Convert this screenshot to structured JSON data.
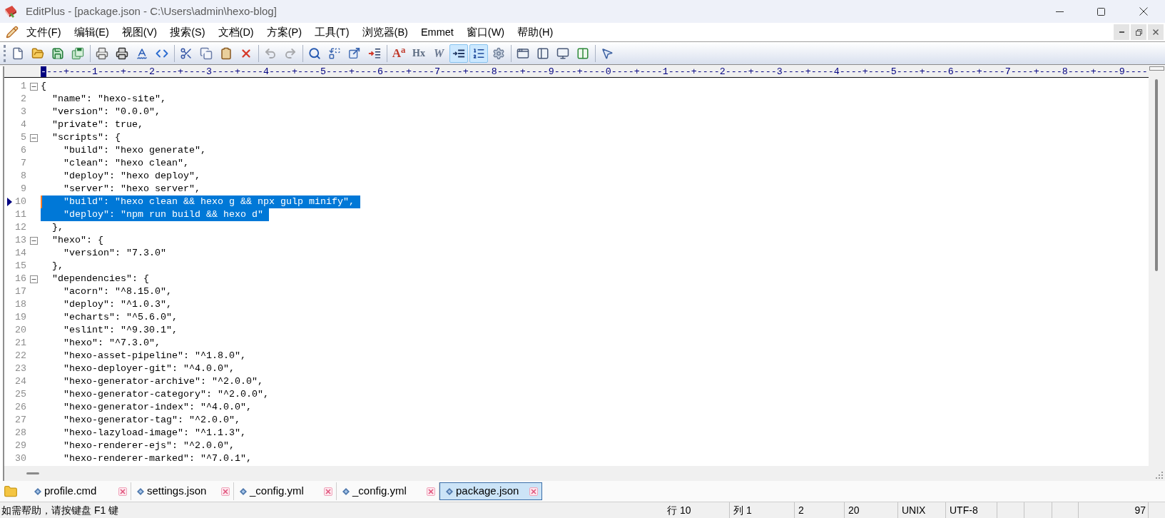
{
  "window": {
    "title": "EditPlus - [package.json - C:\\Users\\admin\\hexo-blog]"
  },
  "menu": [
    "文件(F)",
    "编辑(E)",
    "视图(V)",
    "搜索(S)",
    "文档(D)",
    "方案(P)",
    "工具(T)",
    "浏览器(B)",
    "Emmet",
    "窗口(W)",
    "帮助(H)"
  ],
  "toolbar": {
    "groups": [
      {
        "buttons": [
          {
            "pressed": false,
            "disabled": false
          },
          {
            "pressed": false,
            "disabled": false
          },
          {
            "pressed": false,
            "disabled": false
          },
          {
            "pressed": false,
            "disabled": false
          }
        ]
      },
      {
        "buttons": [
          {
            "pressed": false,
            "disabled": false
          },
          {
            "pressed": false,
            "disabled": false
          },
          {
            "pressed": false,
            "disabled": false
          },
          {
            "pressed": false,
            "disabled": false
          }
        ]
      },
      {
        "buttons": [
          {
            "pressed": false,
            "disabled": false
          },
          {
            "pressed": false,
            "disabled": false
          },
          {
            "pressed": false,
            "disabled": false
          },
          {
            "pressed": false,
            "disabled": false
          }
        ]
      },
      {
        "buttons": [
          {
            "pressed": false,
            "disabled": true
          },
          {
            "pressed": false,
            "disabled": true
          }
        ]
      },
      {
        "buttons": [
          {
            "pressed": false,
            "disabled": false
          },
          {
            "pressed": false,
            "disabled": false
          },
          {
            "pressed": false,
            "disabled": false
          },
          {
            "pressed": false,
            "disabled": false
          }
        ]
      },
      {
        "buttons": [
          {
            "label": "A$^{a}$",
            "pressed": false,
            "disabled": false
          },
          {
            "label": "Hx",
            "pressed": false,
            "disabled": false
          },
          {
            "label": "W",
            "pressed": false,
            "disabled": false
          },
          {
            "pressed": true,
            "disabled": false
          },
          {
            "pressed": true,
            "disabled": false
          },
          {
            "pressed": false,
            "disabled": false
          }
        ]
      },
      {
        "buttons": [
          {
            "pressed": false,
            "disabled": false
          },
          {
            "pressed": false,
            "disabled": false
          },
          {
            "pressed": false,
            "disabled": false
          },
          {
            "pressed": false,
            "disabled": false
          }
        ]
      },
      {
        "buttons": [
          {
            "pressed": false,
            "disabled": false
          }
        ]
      }
    ]
  },
  "ruler": {
    "cursor": "-",
    "scale": "---+----1----+----2----+----3----+----4----+----5----+----6----+----7----+----8----+----9----+----0----+----1----+----2----+----3----+----4----+----5----+----6----+----7----+----8----+----9----"
  },
  "editor": {
    "lines": [
      {
        "number": "1",
        "text": "{",
        "expanded": true,
        "selected": false,
        "current": false
      },
      {
        "number": "2",
        "text": "  \"name\": \"hexo-site\",",
        "selected": false,
        "current": false
      },
      {
        "number": "3",
        "text": "  \"version\": \"0.0.0\",",
        "selected": false,
        "current": false
      },
      {
        "number": "4",
        "text": "  \"private\": true,",
        "selected": false,
        "current": false
      },
      {
        "number": "5",
        "text": "  \"scripts\": {",
        "expanded": true,
        "selected": false,
        "current": false
      },
      {
        "number": "6",
        "text": "    \"build\": \"hexo generate\",",
        "selected": false,
        "current": false
      },
      {
        "number": "7",
        "text": "    \"clean\": \"hexo clean\",",
        "selected": false,
        "current": false
      },
      {
        "number": "8",
        "text": "    \"deploy\": \"hexo deploy\",",
        "selected": false,
        "current": false
      },
      {
        "number": "9",
        "text": "    \"server\": \"hexo server\",",
        "selected": false,
        "current": false
      },
      {
        "number": "10",
        "text": "    \"build\": \"hexo clean && hexo g && npx gulp minify\",",
        "selected": true,
        "current": true
      },
      {
        "number": "11",
        "text": "    \"deploy\": \"npm run build && hexo d\"",
        "selected": true,
        "current": false
      },
      {
        "number": "12",
        "text": "  },",
        "selected": false,
        "current": false
      },
      {
        "number": "13",
        "text": "  \"hexo\": {",
        "expanded": true,
        "selected": false,
        "current": false
      },
      {
        "number": "14",
        "text": "    \"version\": \"7.3.0\"",
        "selected": false,
        "current": false
      },
      {
        "number": "15",
        "text": "  },",
        "selected": false,
        "current": false
      },
      {
        "number": "16",
        "text": "  \"dependencies\": {",
        "expanded": true,
        "selected": false,
        "current": false
      },
      {
        "number": "17",
        "text": "    \"acorn\": \"^8.15.0\",",
        "selected": false,
        "current": false
      },
      {
        "number": "18",
        "text": "    \"deploy\": \"^1.0.3\",",
        "selected": false,
        "current": false
      },
      {
        "number": "19",
        "text": "    \"echarts\": \"^5.6.0\",",
        "selected": false,
        "current": false
      },
      {
        "number": "20",
        "text": "    \"eslint\": \"^9.30.1\",",
        "selected": false,
        "current": false
      },
      {
        "number": "21",
        "text": "    \"hexo\": \"^7.3.0\",",
        "selected": false,
        "current": false
      },
      {
        "number": "22",
        "text": "    \"hexo-asset-pipeline\": \"^1.8.0\",",
        "selected": false,
        "current": false
      },
      {
        "number": "23",
        "text": "    \"hexo-deployer-git\": \"^4.0.0\",",
        "selected": false,
        "current": false
      },
      {
        "number": "24",
        "text": "    \"hexo-generator-archive\": \"^2.0.0\",",
        "selected": false,
        "current": false
      },
      {
        "number": "25",
        "text": "    \"hexo-generator-category\": \"^2.0.0\",",
        "selected": false,
        "current": false
      },
      {
        "number": "26",
        "text": "    \"hexo-generator-index\": \"^4.0.0\",",
        "selected": false,
        "current": false
      },
      {
        "number": "27",
        "text": "    \"hexo-generator-tag\": \"^2.0.0\",",
        "selected": false,
        "current": false
      },
      {
        "number": "28",
        "text": "    \"hexo-lazyload-image\": \"^1.1.3\",",
        "selected": false,
        "current": false
      },
      {
        "number": "29",
        "text": "    \"hexo-renderer-ejs\": \"^2.0.0\",",
        "selected": false,
        "current": false
      },
      {
        "number": "30",
        "text": "    \"hexo-renderer-marked\": \"^7.0.1\",",
        "selected": false,
        "current": false
      }
    ]
  },
  "tabs": [
    {
      "label": "profile.cmd",
      "selected": false
    },
    {
      "label": "settings.json",
      "selected": false
    },
    {
      "label": "_config.yml",
      "selected": false
    },
    {
      "label": "_config.yml",
      "selected": false
    },
    {
      "label": "package.json",
      "selected": true
    }
  ],
  "status_bar": {
    "message": "如需帮助，请按键盘 F1 键",
    "panels": [
      "行 10",
      "列 1",
      "2",
      "20",
      "UNIX",
      "UTF-8",
      "97"
    ]
  }
}
